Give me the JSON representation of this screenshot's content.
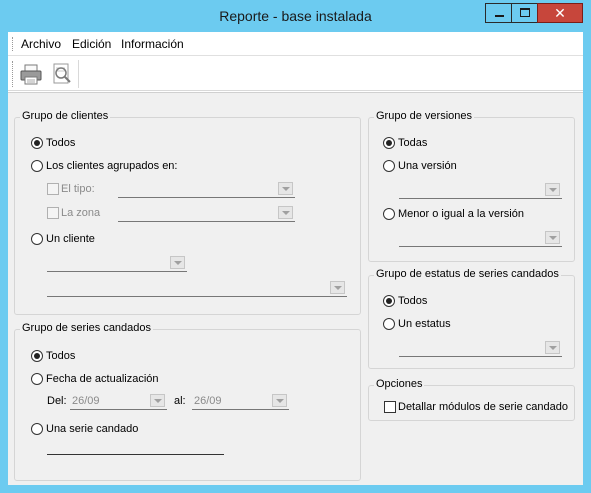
{
  "window": {
    "title": "Reporte - base instalada"
  },
  "menu": {
    "items": [
      "Archivo",
      "Edición",
      "Información"
    ]
  },
  "toolbar": {
    "buttons": [
      "printer-icon",
      "print-preview-icon"
    ]
  },
  "clientes": {
    "title": "Grupo de clientes",
    "todos": "Todos",
    "agrupados": "Los clientes agrupados en:",
    "tipo": "El tipo:",
    "zona": "La zona",
    "uno": "Un cliente",
    "selected": "todos"
  },
  "series": {
    "title": "Grupo de series candados",
    "todos": "Todos",
    "fecha": "Fecha de actualización",
    "del": "Del:",
    "del_value": "26/09",
    "al": "al:",
    "al_value": "26/09",
    "una": "Una serie candado",
    "selected": "todos"
  },
  "versiones": {
    "title": "Grupo de versiones",
    "todas": "Todas",
    "una": "Una versión",
    "menor": "Menor o igual a la versión",
    "selected": "todas"
  },
  "estatus": {
    "title": "Grupo de estatus de series candados",
    "todos": "Todos",
    "uno": "Un estatus",
    "selected": "todos"
  },
  "opciones": {
    "title": "Opciones",
    "detallar": "Detallar módulos de serie candado",
    "detallar_checked": false
  }
}
